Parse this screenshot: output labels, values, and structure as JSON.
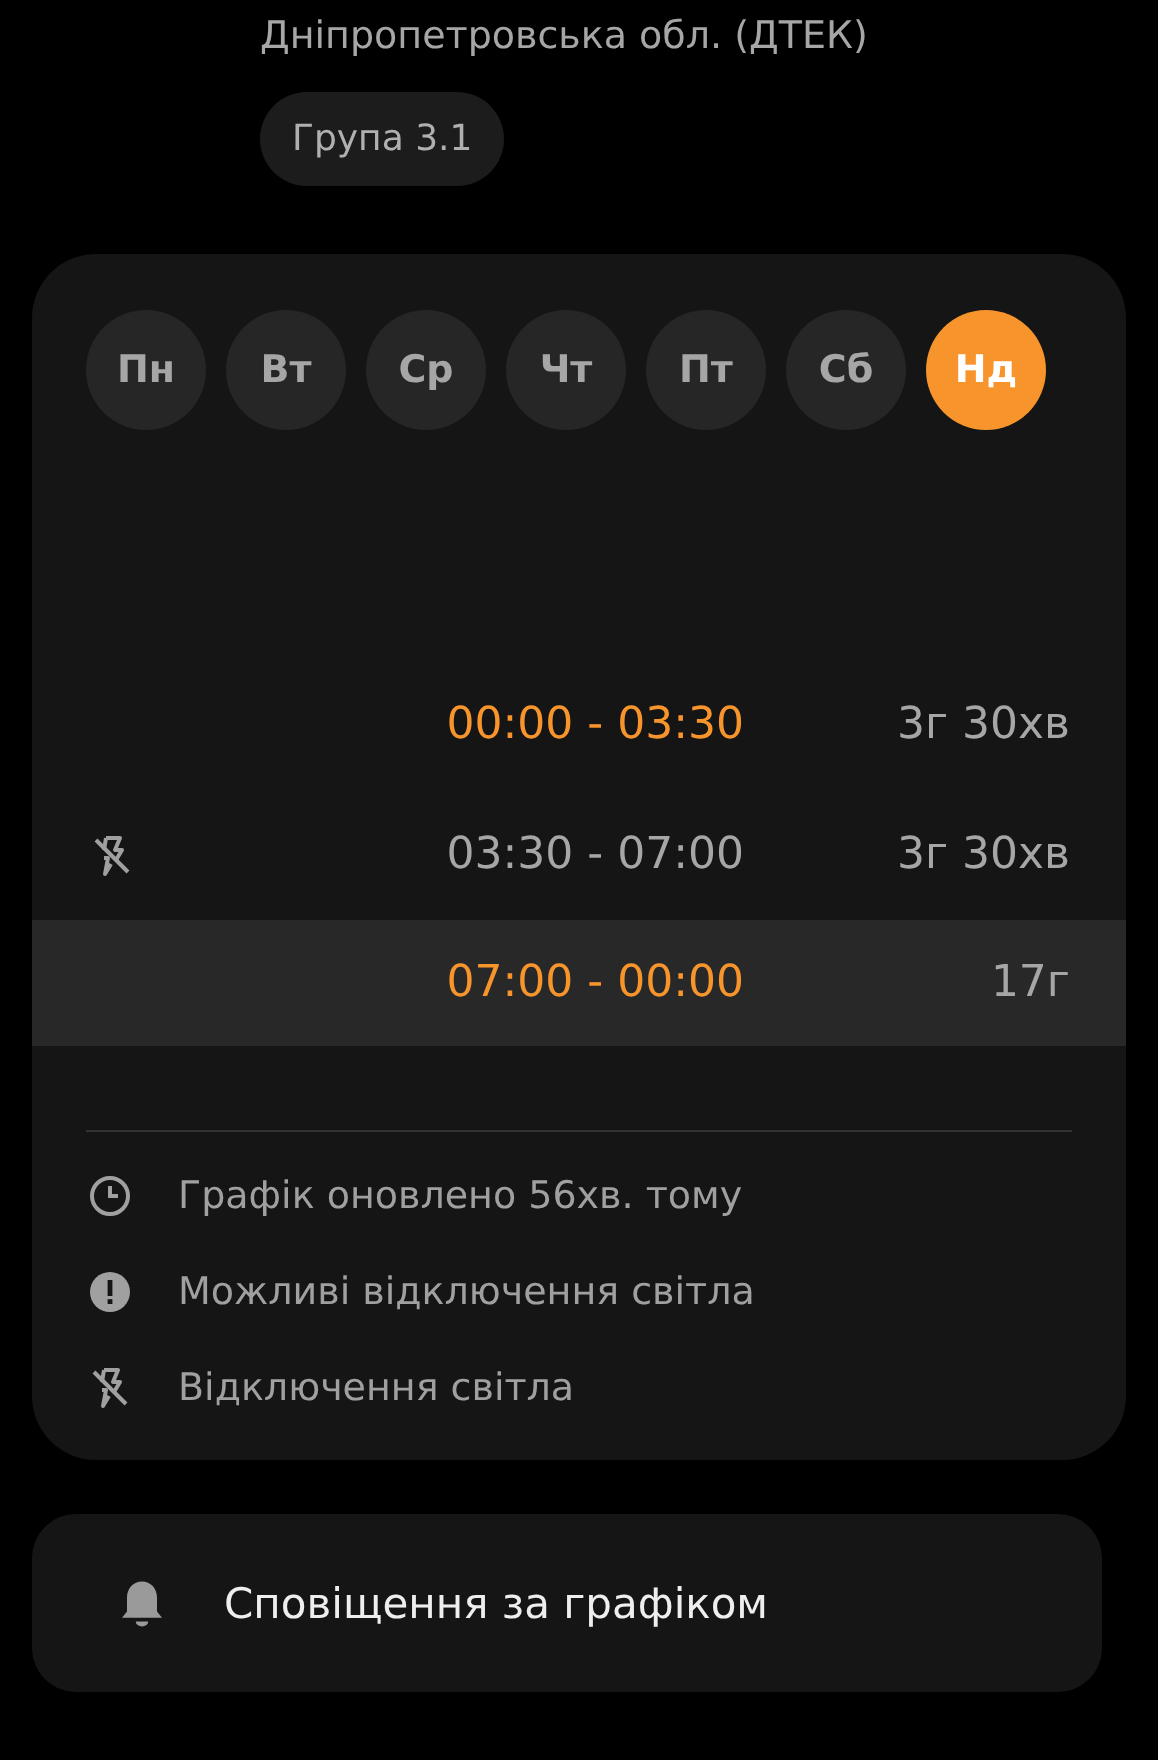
{
  "region": "Дніпропетровська обл. (ДТЕК)",
  "group": "Група 3.1",
  "days": [
    {
      "label": "Пн",
      "selected": false
    },
    {
      "label": "Вт",
      "selected": false
    },
    {
      "label": "Ср",
      "selected": false
    },
    {
      "label": "Чт",
      "selected": false
    },
    {
      "label": "Пт",
      "selected": false
    },
    {
      "label": "Сб",
      "selected": false
    },
    {
      "label": "Нд",
      "selected": true
    }
  ],
  "slots": [
    {
      "kind": "possible",
      "time": "00:00 - 03:30",
      "duration": "3г 30хв",
      "selected": false
    },
    {
      "kind": "outage",
      "time": "03:30 - 07:00",
      "duration": "3г 30хв",
      "selected": false
    },
    {
      "kind": "possible",
      "time": "07:00 - 00:00",
      "duration": "17г",
      "selected": true
    }
  ],
  "legend": [
    {
      "kind": "clock",
      "text": "Графік оновлено 56хв. тому"
    },
    {
      "kind": "warning",
      "text": "Можливі відключення світла"
    },
    {
      "kind": "outage",
      "text": "Відключення світла"
    }
  ],
  "notifications": {
    "label": "Сповіщення за графіком"
  }
}
